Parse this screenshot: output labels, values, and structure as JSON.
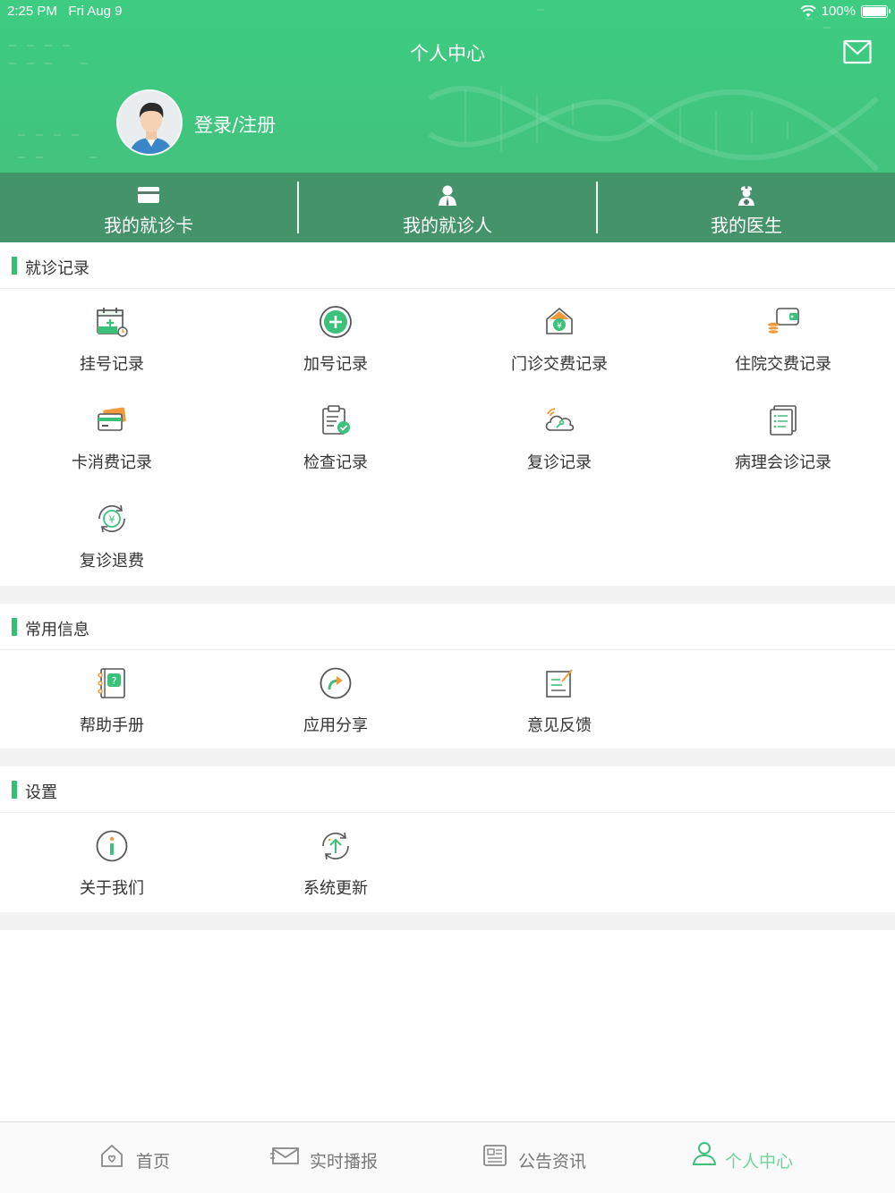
{
  "status": {
    "time": "2:25 PM",
    "date": "Fri Aug 9",
    "battery": "100%"
  },
  "header": {
    "title": "个人中心",
    "login": "登录/注册"
  },
  "quick": [
    {
      "label": "我的就诊卡",
      "icon": "card-icon"
    },
    {
      "label": "我的就诊人",
      "icon": "person-icon"
    },
    {
      "label": "我的医生",
      "icon": "doctor-icon"
    }
  ],
  "records": {
    "title": "就诊记录",
    "items": [
      {
        "label": "挂号记录",
        "icon": "calendar-add-icon"
      },
      {
        "label": "加号记录",
        "icon": "plus-circle-icon"
      },
      {
        "label": "门诊交费记录",
        "icon": "yuan-house-icon"
      },
      {
        "label": "住院交费记录",
        "icon": "wallet-coins-icon"
      },
      {
        "label": "卡消费记录",
        "icon": "cards-icon"
      },
      {
        "label": "检查记录",
        "icon": "clipboard-check-icon"
      },
      {
        "label": "复诊记录",
        "icon": "cloud-stethoscope-icon"
      },
      {
        "label": "病理会诊记录",
        "icon": "document-list-icon"
      },
      {
        "label": "复诊退费",
        "icon": "yuan-refresh-icon"
      }
    ]
  },
  "common": {
    "title": "常用信息",
    "items": [
      {
        "label": "帮助手册",
        "icon": "help-book-icon"
      },
      {
        "label": "应用分享",
        "icon": "share-icon"
      },
      {
        "label": "意见反馈",
        "icon": "feedback-icon"
      }
    ]
  },
  "settings": {
    "title": "设置",
    "items": [
      {
        "label": "关于我们",
        "icon": "info-icon"
      },
      {
        "label": "系统更新",
        "icon": "update-icon"
      }
    ]
  },
  "tabs": [
    {
      "label": "首页",
      "icon": "home-icon"
    },
    {
      "label": "实时播报",
      "icon": "broadcast-icon"
    },
    {
      "label": "公告资讯",
      "icon": "news-icon"
    },
    {
      "label": "个人中心",
      "icon": "user-icon",
      "active": true
    }
  ],
  "colors": {
    "primary": "#3dc47e",
    "accent_bar": "#33c073",
    "active_tab": "#6fd49b",
    "orange": "#f29a3a"
  }
}
